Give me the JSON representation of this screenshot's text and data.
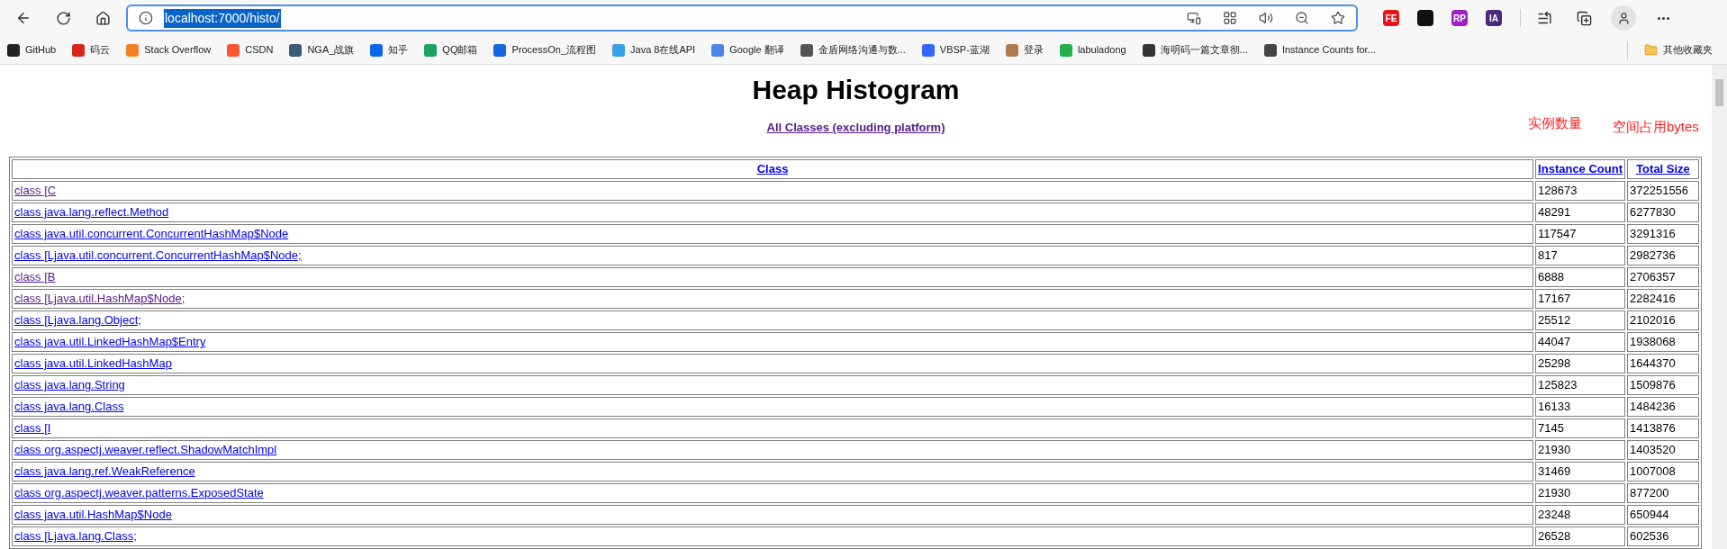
{
  "browser": {
    "url": {
      "text": "localhost:7000/histo/",
      "selected": true
    },
    "extensions": [
      {
        "label": "FE",
        "color": "#e8141b"
      },
      {
        "color": "#111111"
      },
      {
        "label": "RP",
        "color": "#a020c8"
      },
      {
        "label": "IA",
        "color": "#4a2a7a"
      }
    ],
    "bookmarks": [
      {
        "label": "GitHub",
        "color": "#222222"
      },
      {
        "label": "码云",
        "color": "#d9261c"
      },
      {
        "label": "Stack Overflow",
        "color": "#f48024"
      },
      {
        "label": "CSDN",
        "color": "#fc5531"
      },
      {
        "label": "NGA_战旗",
        "color": "#3a5a78"
      },
      {
        "label": "知乎",
        "color": "#0a66e8"
      },
      {
        "label": "QQ邮箱",
        "color": "#1aa260"
      },
      {
        "label": "ProcessOn_流程图",
        "color": "#1565e0"
      },
      {
        "label": "Java 8在线API",
        "color": "#3aa0e8"
      },
      {
        "label": "Google 翻译",
        "color": "#4a86e8"
      },
      {
        "label": "金盾网络沟通与数...",
        "color": "#555555"
      },
      {
        "label": "VBSP-蓝湖",
        "color": "#3366ff"
      },
      {
        "label": "登录",
        "color": "#b07a50"
      },
      {
        "label": "labuladong",
        "color": "#22b14c"
      },
      {
        "label": "海明码一篇文章彻...",
        "color": "#333333"
      },
      {
        "label": "Instance Counts for...",
        "color": "#444444"
      }
    ],
    "other_bookmarks": "其他收藏夹"
  },
  "page": {
    "title": "Heap Histogram",
    "all_classes_link": {
      "text": "All Classes (excluding platform)",
      "visited": true
    },
    "annotations": [
      "实例数量",
      "空间占用bytes"
    ],
    "table": {
      "columns": [
        "Class",
        "Instance Count",
        "Total Size"
      ],
      "rows": [
        {
          "class": "class [C",
          "count": "128673",
          "size": "372251556",
          "visited": true
        },
        {
          "class": "class java.lang.reflect.Method",
          "count": "48291",
          "size": "6277830",
          "visited": false
        },
        {
          "class": "class java.util.concurrent.ConcurrentHashMap$Node",
          "count": "117547",
          "size": "3291316",
          "visited": false
        },
        {
          "class": "class [Ljava.util.concurrent.ConcurrentHashMap$Node;",
          "count": "817",
          "size": "2982736",
          "visited": false
        },
        {
          "class": "class [B",
          "count": "6888",
          "size": "2706357",
          "visited": true
        },
        {
          "class": "class [Ljava.util.HashMap$Node;",
          "count": "17167",
          "size": "2282416",
          "visited": true
        },
        {
          "class": "class [Ljava.lang.Object;",
          "count": "25512",
          "size": "2102016",
          "visited": false
        },
        {
          "class": "class java.util.LinkedHashMap$Entry",
          "count": "44047",
          "size": "1938068",
          "visited": false
        },
        {
          "class": "class java.util.LinkedHashMap",
          "count": "25298",
          "size": "1644370",
          "visited": false
        },
        {
          "class": "class java.lang.String",
          "count": "125823",
          "size": "1509876",
          "visited": false
        },
        {
          "class": "class java.lang.Class",
          "count": "16133",
          "size": "1484236",
          "visited": false
        },
        {
          "class": "class [I",
          "count": "7145",
          "size": "1413876",
          "visited": false
        },
        {
          "class": "class org.aspectj.weaver.reflect.ShadowMatchImpl",
          "count": "21930",
          "size": "1403520",
          "visited": false
        },
        {
          "class": "class java.lang.ref.WeakReference",
          "count": "31469",
          "size": "1007008",
          "visited": false
        },
        {
          "class": "class org.aspectj.weaver.patterns.ExposedState",
          "count": "21930",
          "size": "877200",
          "visited": false
        },
        {
          "class": "class java.util.HashMap$Node",
          "count": "23248",
          "size": "650944",
          "visited": false
        },
        {
          "class": "class [Ljava.lang.Class;",
          "count": "26528",
          "size": "602536",
          "visited": false
        }
      ]
    }
  }
}
